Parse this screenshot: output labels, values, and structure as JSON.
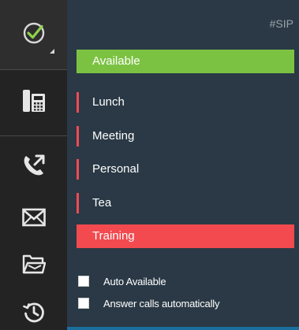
{
  "header": {
    "tag": "#SIP"
  },
  "statuses": [
    {
      "label": "Available"
    },
    {
      "label": "Lunch"
    },
    {
      "label": "Meeting"
    },
    {
      "label": "Personal"
    },
    {
      "label": "Tea"
    },
    {
      "label": "Training"
    }
  ],
  "options": [
    {
      "label": "Auto Available",
      "checked": false
    },
    {
      "label": "Answer calls automatically",
      "checked": false
    }
  ],
  "sidebar": {
    "icons": [
      "check-circle-icon",
      "phone-system-icon",
      "call-transfer-icon",
      "envelope-icon",
      "open-folder-icon",
      "history-icon"
    ]
  },
  "colors": {
    "available": "#7cc242",
    "away_bar": "#ef4b55",
    "training": "#f24a4f",
    "panel_bg": "#2a3945",
    "rail_bg": "#232323"
  }
}
